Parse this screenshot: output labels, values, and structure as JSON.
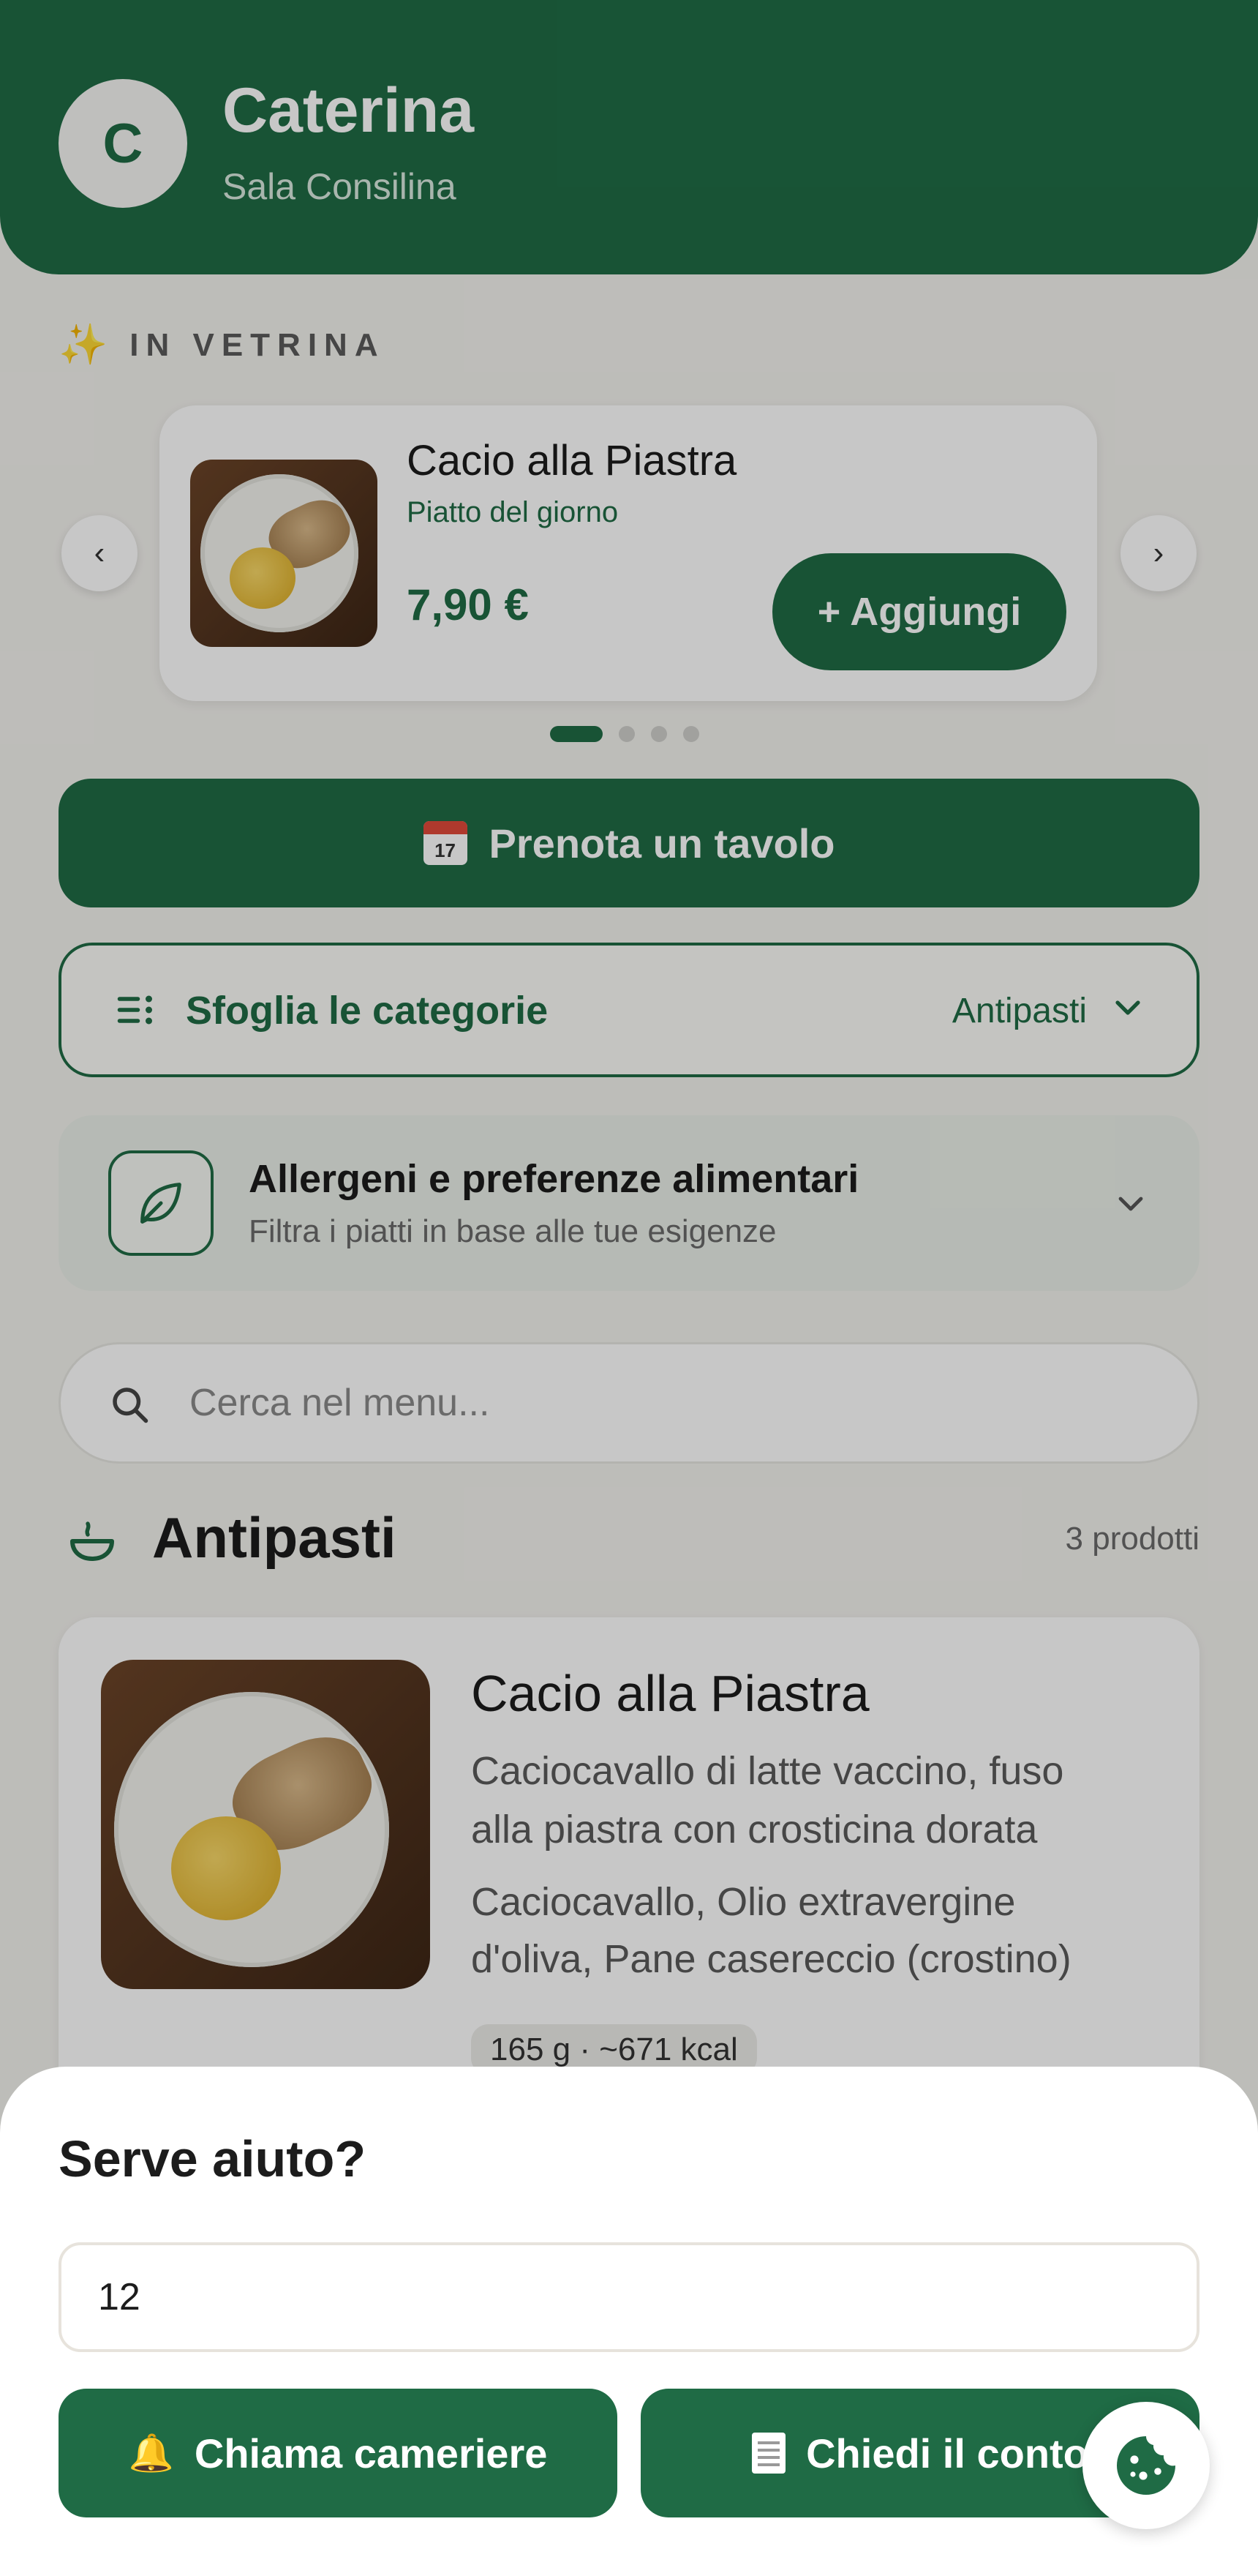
{
  "colors": {
    "accent": "#1f6b45",
    "background": "#f3f2ee"
  },
  "header": {
    "avatar_initial": "C",
    "name": "Caterina",
    "city": "Sala Consilina"
  },
  "featured": {
    "label": "IN VETRINA",
    "icon": "sparkles-icon",
    "item_title": "Cacio alla Piastra",
    "item_subtitle": "Piatto del giorno",
    "price": "7,90 €",
    "add_label": "+ Aggiungi",
    "prev_symbol": "‹",
    "next_symbol": "›",
    "active_slide": 1,
    "slide_count": 4
  },
  "book": {
    "icon_text": "17",
    "label": "Prenota un tavolo"
  },
  "categories": {
    "label": "Sfoglia le categorie",
    "current": "Antipasti"
  },
  "allergens": {
    "title": "Allergeni e preferenze alimentari",
    "subtitle": "Filtra i piatti in base alle tue esigenze"
  },
  "search": {
    "placeholder": "Cerca nel menu..."
  },
  "section": {
    "title": "Antipasti",
    "count": "3 prodotti"
  },
  "product": {
    "title": "Cacio alla Piastra",
    "description": "Caciocavallo di latte vaccino, fuso alla piastra con crosticina dorata",
    "ingredients": "Caciocavallo, Olio extravergine d'oliva, Pane casereccio (crostino)",
    "tag": "165 g · ~671 kcal"
  },
  "help_sheet": {
    "title": "Serve aiuto?",
    "table_value": "12",
    "call_waiter_label": "Chiama cameriere",
    "request_bill_label": "Chiedi il conto"
  }
}
